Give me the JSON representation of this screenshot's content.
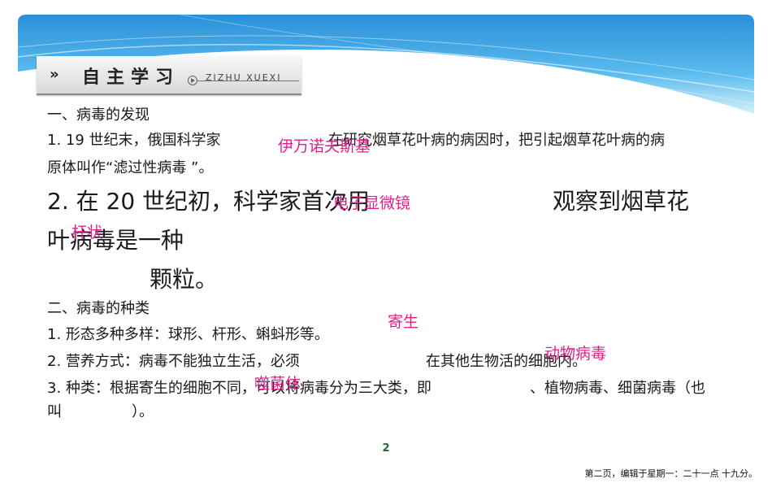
{
  "header": {
    "title": "自主学习",
    "subtitle": "ZIZHU XUEXI",
    "chevron": "»"
  },
  "section1": {
    "heading": "一、病毒的发现",
    "q1_line1_a": "1. 19 世纪末，俄国科学家",
    "q1_line1_b": "在研究烟草花叶病的病因时，把引起烟草花叶病的病",
    "q1_line2": "原体叫作“滤过性病毒 ”。",
    "q2_line1_a": "2. 在 20 世纪初，科学家首次用",
    "q2_line1_b": "观察到烟草花",
    "q2_line2": "叶病毒是一种",
    "q2_line3": "颗粒。"
  },
  "section2": {
    "heading": "二、病毒的种类",
    "q1": "1. 形态多种多样：球形、杆形、蝌蚪形等。",
    "q2_a": "2. 营养方式：病毒不能独立生活，必须",
    "q2_b": "在其他生物活的细胞内。",
    "q3_a": "3. 种类：根据寄生的细胞不同，可以将病毒分为三大类，即",
    "q3_b": "、植物病毒、细菌病毒（也",
    "q3_line2_a": "叫",
    "q3_line2_b": "）。"
  },
  "answers": {
    "a1": "伊万诺夫斯基",
    "a2": "电子显微镜",
    "a3": "杆状",
    "a4": "寄生",
    "a5": "动物病毒",
    "a6": "噬菌体"
  },
  "page_number": "2",
  "footer": "第二页，编辑于星期一：二十一点 十九分。",
  "colors": {
    "answer": "#e0208a",
    "banner_dark": "#2f93d6",
    "banner_light": "#bfe7f8"
  }
}
